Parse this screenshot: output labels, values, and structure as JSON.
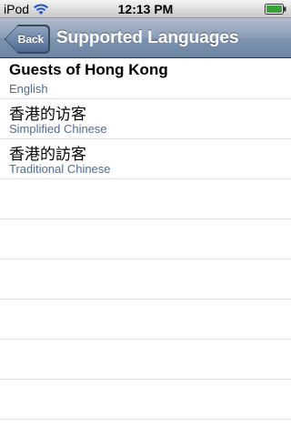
{
  "status_bar": {
    "carrier": "iPod",
    "time": "12:13 PM",
    "icons": [
      "wifi-icon",
      "battery-icon"
    ]
  },
  "nav_bar": {
    "back_label": "Back",
    "title": "Supported Languages"
  },
  "languages": [
    {
      "title": "Guests of Hong Kong",
      "subtitle": "English"
    },
    {
      "title": "香港的访客",
      "subtitle": "Simplified Chinese"
    },
    {
      "title": "香港的訪客",
      "subtitle": "Traditional Chinese"
    }
  ],
  "colors": {
    "nav_bar": "#7d93b0",
    "subtitle": "#4f6c98",
    "separator": "#e0e0e0"
  }
}
